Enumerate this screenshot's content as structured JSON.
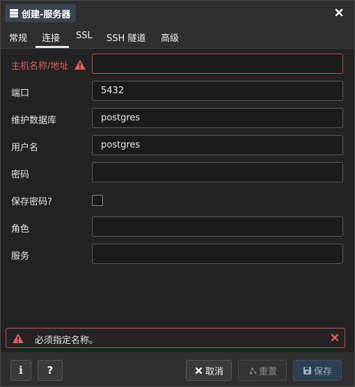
{
  "dialog": {
    "title": "创建-服务器"
  },
  "tabs": [
    {
      "label": "常规"
    },
    {
      "label": "连接"
    },
    {
      "label": "SSL"
    },
    {
      "label": "SSH 隧道"
    },
    {
      "label": "高级"
    }
  ],
  "active_tab": "连接",
  "form": {
    "host": {
      "label": "主机名称/地址",
      "value": ""
    },
    "port": {
      "label": "端口",
      "value": "5432"
    },
    "maintenance_db": {
      "label": "维护数据库",
      "value": "postgres"
    },
    "username": {
      "label": "用户名",
      "value": "postgres"
    },
    "password": {
      "label": "密码",
      "value": ""
    },
    "save_password": {
      "label": "保存密码?",
      "checked": false
    },
    "role": {
      "label": "角色",
      "value": ""
    },
    "service": {
      "label": "服务",
      "value": ""
    }
  },
  "error": {
    "message": "必须指定名称。"
  },
  "footer": {
    "info_label": "i",
    "help_label": "?",
    "cancel_label": "取消",
    "reset_label": "重置",
    "save_label": "保存"
  },
  "colors": {
    "error": "#e35d5d",
    "accent": "#2c3e52"
  }
}
